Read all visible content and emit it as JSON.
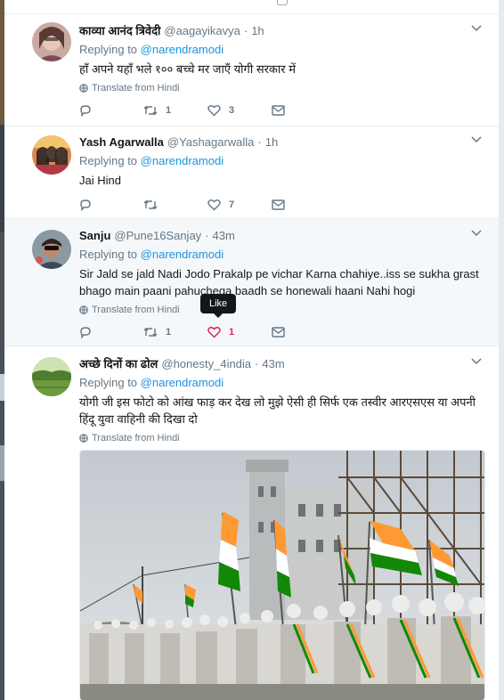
{
  "tweets": [
    {
      "name": "काव्या आनंद त्रिवेदी",
      "handle": "@aagayikavya",
      "time": "1h",
      "replying_label": "Replying to",
      "replying_to": "@narendramodi",
      "text": "हाँ अपने यहाँ भले १०० बच्चे मर जाएँ योगी सरकार में",
      "translate": "Translate from Hindi",
      "reply_count": "",
      "retweet_count": "1",
      "like_count": "3"
    },
    {
      "name": "Yash Agarwalla",
      "handle": "@Yashagarwalla",
      "time": "1h",
      "replying_label": "Replying to",
      "replying_to": "@narendramodi",
      "text": "Jai Hind",
      "reply_count": "",
      "retweet_count": "",
      "like_count": "7"
    },
    {
      "name": "Sanju",
      "handle": "@Pune16Sanjay",
      "time": "43m",
      "replying_label": "Replying to",
      "replying_to": "@narendramodi",
      "text": "Sir Jald se jald Nadi Jodo Prakalp pe vichar Karna chahiye..iss se sukha grast bhago main paani  pahuchega baadh se honewali haani Nahi hogi",
      "translate": "Translate from Hindi",
      "reply_count": "",
      "retweet_count": "1",
      "like_count": "1",
      "tooltip": "Like"
    },
    {
      "name": "अच्छे दिनों का ढोल",
      "handle": "@honesty_4india",
      "time": "43m",
      "replying_label": "Replying to",
      "replying_to": "@narendramodi",
      "text": "योगी जी इस फोटो को आंख फाड़ कर देख लो मुझे ऐसी ही सिर्फ एक तस्वीर आरएसएस या अपनी हिंदू युवा वाहिनी की दिखा दो",
      "translate": "Translate from Hindi"
    }
  ],
  "colors": {
    "link": "#1b95e0",
    "secondary": "#657786",
    "like_active": "#e0245e",
    "saffron": "#ff9933",
    "green": "#138808"
  },
  "icons": [
    "reply-icon",
    "retweet-icon",
    "heart-icon",
    "dm-icon",
    "globe-icon",
    "chevron-down-icon"
  ]
}
